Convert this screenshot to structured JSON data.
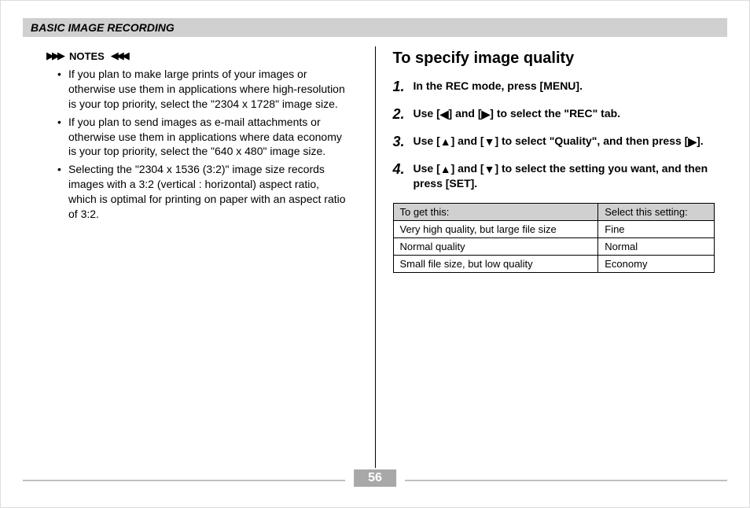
{
  "section_title": "BASIC IMAGE RECORDING",
  "notes": {
    "label": "NOTES",
    "left_decoration": "▶▶▶",
    "right_decoration": "◀◀◀",
    "items": [
      "If you plan to make large prints of your images or otherwise use them in applications where high-resolution is your top priority, select the \"2304 x 1728\" image size.",
      "If you plan to send images as e-mail attachments or otherwise use them in applications where data economy is your top priority, select the \"640 x 480\" image size.",
      "Selecting the \"2304 x 1536 (3:2)\" image size records images with a 3:2 (vertical : horizontal) aspect ratio, which is optimal for printing on paper with an aspect ratio of 3:2."
    ]
  },
  "right": {
    "heading": "To specify image quality",
    "steps": [
      {
        "pre": "In the REC mode, press [MENU]."
      },
      {
        "pre": "Use [",
        "a1": "◀",
        "mid1": "] and [",
        "a2": "▶",
        "post": "] to select the \"REC\" tab."
      },
      {
        "pre": "Use [",
        "a1": "▲",
        "mid1": "] and [",
        "a2": "▼",
        "mid2": "] to select \"Quality\", and then press [",
        "a3": "▶",
        "post": "]."
      },
      {
        "pre": "Use [",
        "a1": "▲",
        "mid1": "] and [",
        "a2": "▼",
        "post": "] to select the setting you want, and then press [SET]."
      }
    ],
    "table": {
      "headers": [
        "To get this:",
        "Select this setting:"
      ],
      "rows": [
        [
          "Very high quality, but large file size",
          "Fine"
        ],
        [
          "Normal quality",
          "Normal"
        ],
        [
          "Small file size, but low quality",
          "Economy"
        ]
      ]
    }
  },
  "page_number": "56"
}
